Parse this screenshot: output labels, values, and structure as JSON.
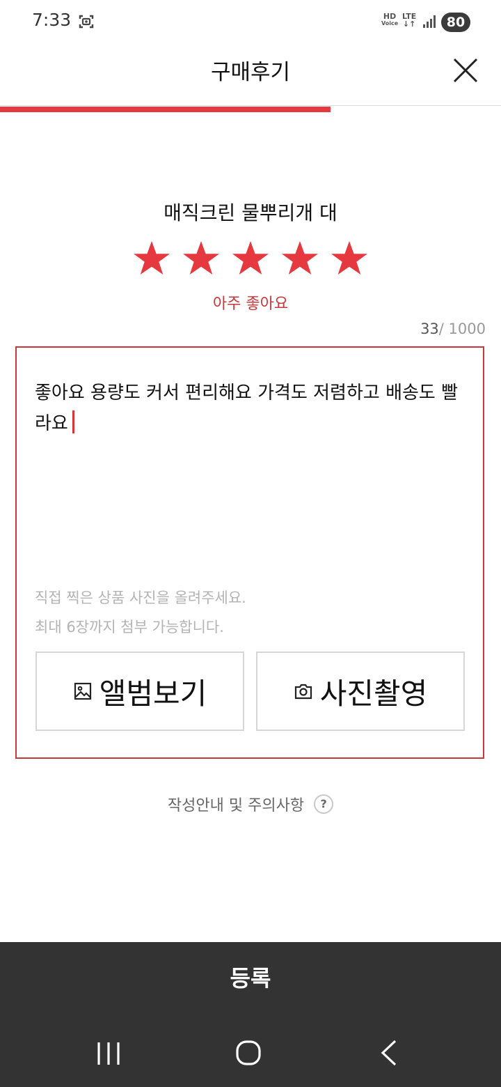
{
  "status_bar": {
    "time": "7:33",
    "hd_top": "HD",
    "hd_bottom": "Voice",
    "lte_top": "LTE",
    "lte_bottom": "↓↑",
    "battery": "80"
  },
  "header": {
    "title": "구매후기",
    "close_icon": "close-icon"
  },
  "progress": {
    "fraction": 0.66,
    "color": "#e5383f"
  },
  "product": {
    "name": "매직크린 물뿌리개 대"
  },
  "rating": {
    "stars_filled": 5,
    "stars_total": 5,
    "label": "아주 좋아요",
    "star_color": "#e5383f"
  },
  "review": {
    "count": "33",
    "limit": "/ 1000",
    "text": "좋아요 용량도 커서 편리해요 가격도 저렴하고 배송도 빨라요"
  },
  "photo": {
    "hint_line1": "직접 찍은 상품 사진을 올려주세요.",
    "hint_line2": "최대 6장까지 첨부 가능합니다.",
    "album_label": "앨범보기",
    "album_icon": "image-icon",
    "camera_label": "사진촬영",
    "camera_icon": "camera-icon"
  },
  "guide": {
    "label": "작성안내 및 주의사항",
    "icon": "?"
  },
  "footer": {
    "register_label": "등록"
  },
  "nav": {
    "recent_icon": "recent-apps-icon",
    "home_icon": "home-icon",
    "back_icon": "back-icon"
  }
}
